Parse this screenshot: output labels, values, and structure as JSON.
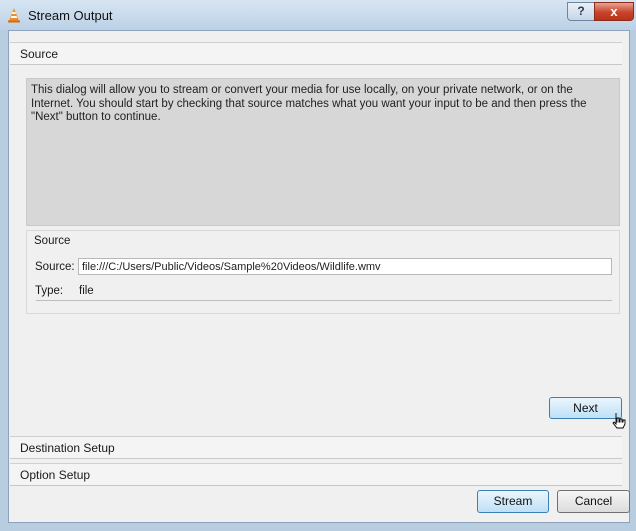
{
  "window": {
    "title": "Stream Output",
    "help_label": "?",
    "close_label": "x"
  },
  "source_section": {
    "header": "Source",
    "info_text": "This dialog will allow you to stream or convert your media for use locally, on your private network, or on the Internet. You should start by checking that source matches what you want your input to be and then press the \"Next\" button to continue.",
    "group_title": "Source",
    "source_label": "Source:",
    "source_value": "file:///C:/Users/Public/Videos/Sample%20Videos/Wildlife.wmv",
    "type_label": "Type:",
    "type_value": "file"
  },
  "buttons": {
    "next": "Next",
    "stream": "Stream",
    "cancel": "Cancel"
  },
  "sections": {
    "destination": "Destination Setup",
    "option": "Option Setup"
  }
}
